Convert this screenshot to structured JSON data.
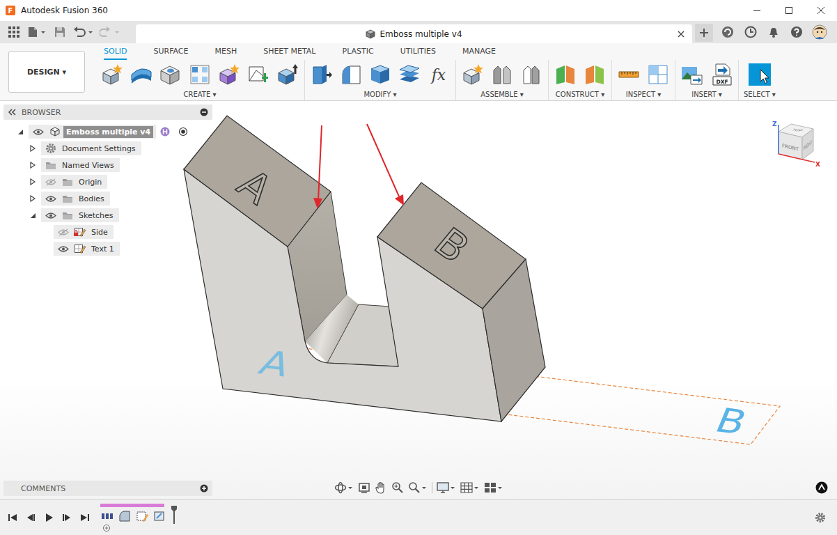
{
  "window": {
    "title": "Autodesk Fusion 360",
    "logo": "F"
  },
  "document_tab": {
    "title": "Emboss multiple v4"
  },
  "workspace": {
    "label": "DESIGN ▾"
  },
  "toolbar_tabs": [
    {
      "label": "SOLID",
      "selected": true
    },
    {
      "label": "SURFACE",
      "selected": false
    },
    {
      "label": "MESH",
      "selected": false
    },
    {
      "label": "SHEET METAL",
      "selected": false
    },
    {
      "label": "PLASTIC",
      "selected": false
    },
    {
      "label": "UTILITIES",
      "selected": false
    },
    {
      "label": "MANAGE",
      "selected": false
    }
  ],
  "tool_groups": [
    {
      "label": "CREATE ▾"
    },
    {
      "label": "MODIFY ▾",
      "icon_text": "fx"
    },
    {
      "label": "ASSEMBLE ▾"
    },
    {
      "label": "CONSTRUCT ▾"
    },
    {
      "label": "INSPECT ▾"
    },
    {
      "label": "INSERT ▾",
      "icon_text": "DXF"
    },
    {
      "label": "SELECT ▾"
    }
  ],
  "browser": {
    "title": "BROWSER",
    "items": [
      {
        "label": "Emboss multiple v4",
        "depth": 0,
        "kind": "component",
        "expandable": true,
        "expanded": true,
        "visible": true,
        "active": true,
        "selected": true
      },
      {
        "label": "Document Settings",
        "depth": 1,
        "kind": "settings",
        "expandable": true,
        "expanded": false,
        "selected": false
      },
      {
        "label": "Named Views",
        "depth": 1,
        "kind": "folder",
        "expandable": true,
        "expanded": false,
        "selected": false
      },
      {
        "label": "Origin",
        "depth": 1,
        "kind": "folder",
        "expandable": true,
        "expanded": false,
        "visible": false,
        "selected": false
      },
      {
        "label": "Bodies",
        "depth": 1,
        "kind": "folder",
        "expandable": true,
        "expanded": false,
        "visible": true,
        "selected": false
      },
      {
        "label": "Sketches",
        "depth": 1,
        "kind": "folder",
        "expandable": true,
        "expanded": true,
        "visible": true,
        "selected": false
      },
      {
        "label": "Side",
        "depth": 2,
        "kind": "sketch",
        "expandable": false,
        "expanded": false,
        "visible": false,
        "locked": true,
        "selected": false
      },
      {
        "label": "Text 1",
        "depth": 2,
        "kind": "sketch",
        "expandable": false,
        "expanded": false,
        "visible": true,
        "locked": false,
        "selected": false
      }
    ]
  },
  "comments": {
    "title": "COMMENTS"
  },
  "viewcube": {
    "top": "TOP",
    "front": "FRONT",
    "right": "RIGHT",
    "axes": [
      {
        "label": "Z",
        "color": "#3b6fd6"
      },
      {
        "label": "X",
        "color": "#e03030"
      }
    ]
  },
  "model": {
    "embossed_text": [
      "A",
      "B"
    ],
    "sketch_text": [
      "A",
      "B"
    ]
  }
}
